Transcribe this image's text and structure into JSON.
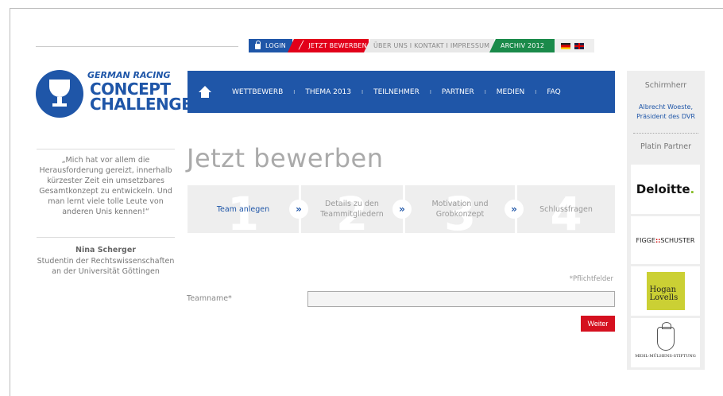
{
  "topnav": {
    "login": "LOGIN",
    "bewerben": "JETZT BEWERBEN",
    "links": "ÜBER UNS I KONTAKT I IMPRESSUM",
    "archiv": "ARCHIV 2012"
  },
  "logo": {
    "line1": "GERMAN RACING",
    "line2": "CONCEPT",
    "line3": "CHALLENGE"
  },
  "mainnav": {
    "items": [
      "WETTBEWERB",
      "THEMA 2013",
      "TEILNEHMER",
      "PARTNER",
      "MEDIEN",
      "FAQ"
    ],
    "separator": "I"
  },
  "sidebar": {
    "schirmherr_title": "Schirmherr",
    "schirmherr_name": "Albrecht Woeste, Präsident des DVR",
    "platin_title": "Platin Partner",
    "sponsors": {
      "deloitte": "Deloitte",
      "deloitte_dot": ".",
      "figge_left": "FIGGE",
      "figge_mark": "::",
      "figge_right": "SCHUSTER",
      "hogan_1": "Hogan",
      "hogan_2": "Lovells",
      "mehl": "MEHL-MÜLHENS-STIFTUNG"
    }
  },
  "quote": {
    "text": "„Mich hat vor allem die Herausforderung gereizt, innerhalb kürzester Zeit ein umsetzbares Gesamtkonzept zu entwickeln. Und man lernt viele tolle Leute von anderen Unis kennen!“",
    "name": "Nina Scherger",
    "subtitle": "Studentin der Rechtswissenschaften an der Universität Göttingen"
  },
  "page": {
    "title": "Jetzt bewerben"
  },
  "steps": [
    {
      "num": "1",
      "label": "Team anlegen"
    },
    {
      "num": "2",
      "label": "Details zu den Teammitgliedern"
    },
    {
      "num": "3",
      "label": "Motivation und Grobkonzept"
    },
    {
      "num": "4",
      "label": "Schlussfragen"
    }
  ],
  "step_arrow": "»",
  "form": {
    "required_note": "*Pflichtfelder",
    "teamname_label": "Teamname*",
    "teamname_value": "",
    "submit": "Weiter"
  },
  "colors": {
    "brand_blue": "#1f56a8",
    "red": "#e2001a",
    "green": "#1a8a4a"
  }
}
